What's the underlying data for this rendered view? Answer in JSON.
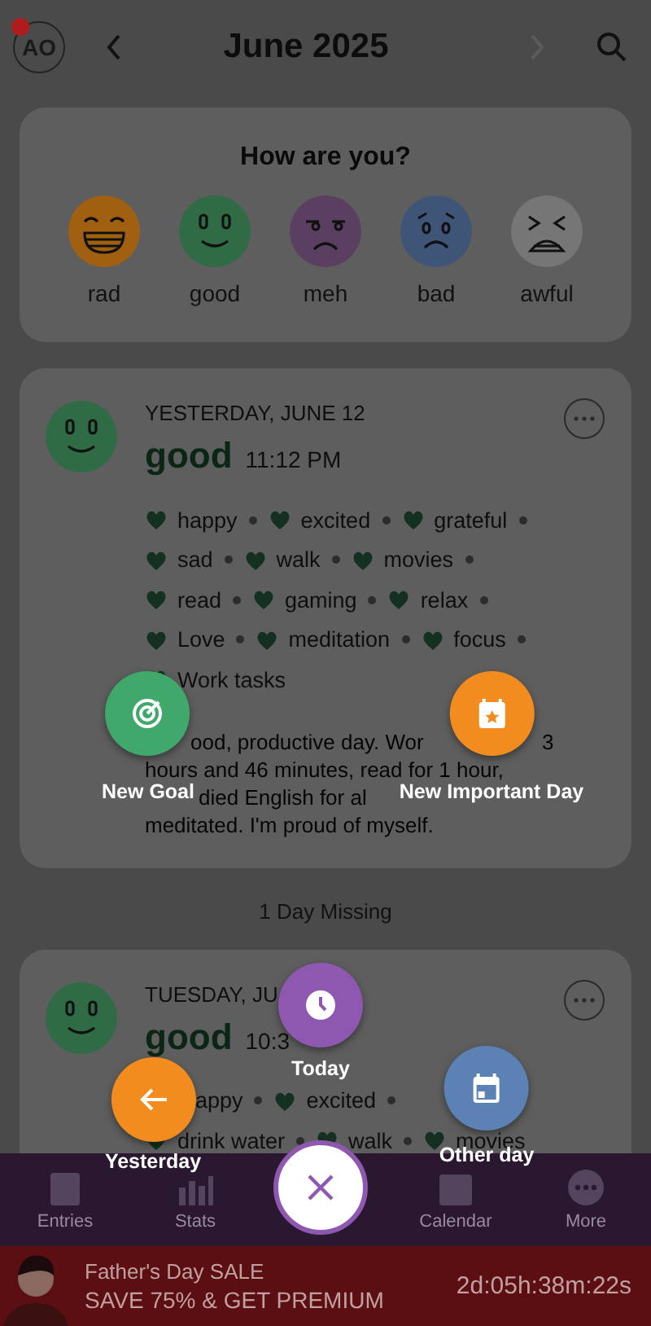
{
  "header": {
    "avatar": "AO",
    "notification": true,
    "title": "June 2025",
    "next_disabled": true
  },
  "mood_picker": {
    "title": "How are you?",
    "moods": [
      {
        "kind": "rad",
        "label": "rad",
        "color": "#a0600f"
      },
      {
        "kind": "good",
        "label": "good",
        "color": "#2f6b45"
      },
      {
        "kind": "meh",
        "label": "meh",
        "color": "#5a3f60"
      },
      {
        "kind": "bad",
        "label": "bad",
        "color": "#3f5577"
      },
      {
        "kind": "awful",
        "label": "awful",
        "color": "#767676"
      }
    ]
  },
  "entries": [
    {
      "kind": "good",
      "date": "YESTERDAY, JUNE 12",
      "mood": "good",
      "time": "11:12 PM",
      "activity_rows": [
        [
          "happy",
          "excited",
          "grateful"
        ],
        [
          "sad",
          "walk",
          "movies"
        ],
        [
          "read",
          "gaming",
          "relax"
        ],
        [
          "Love",
          "meditation",
          "focus"
        ],
        [
          "Work tasks"
        ]
      ],
      "note_lines": [
        [
          "ood, productive day. Wor",
          "3"
        ],
        [
          "hours and 46 minutes, read for 1 hour,"
        ],
        [
          "died English for al"
        ],
        [
          "meditated. I'm proud of myself."
        ]
      ]
    },
    {
      "kind": "good",
      "date": "TUESDAY, JU",
      "mood": "good",
      "time": "10:3",
      "activity_rows": [
        [
          {
            "label": "appy",
            "icon": false
          },
          "excited"
        ],
        [
          "drink water",
          "walk",
          "movies"
        ]
      ]
    }
  ],
  "missing": "1 Day Missing",
  "nav": [
    {
      "kind": "entries",
      "label": "Entries"
    },
    {
      "kind": "stats",
      "label": "Stats"
    },
    {
      "kind": "center"
    },
    {
      "kind": "calendar",
      "label": "Calendar"
    },
    {
      "kind": "more",
      "label": "More"
    }
  ],
  "banner": {
    "title": "Father's Day SALE",
    "offer": "SAVE 75% & GET PREMIUM",
    "countdown": "2d:05h:38m:22s"
  },
  "fab_menu": [
    {
      "kind": "goal",
      "label": "New Goal",
      "color": "#3fa86a"
    },
    {
      "kind": "important_day",
      "label": "New Important Day",
      "color": "#f28c1f"
    },
    {
      "kind": "today",
      "label": "Today",
      "color": "#8e57b0"
    },
    {
      "kind": "yesterday",
      "label": "Yesterday",
      "color": "#f28c1f"
    },
    {
      "kind": "other_day",
      "label": "Other day",
      "color": "#5b81b5"
    }
  ]
}
